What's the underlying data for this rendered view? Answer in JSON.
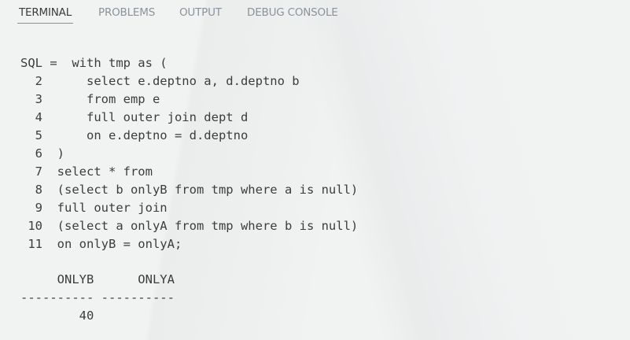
{
  "tabs": [
    {
      "label": "TERMINAL",
      "active": true
    },
    {
      "label": "PROBLEMS",
      "active": false
    },
    {
      "label": "OUTPUT",
      "active": false
    },
    {
      "label": "DEBUG CONSOLE",
      "active": false
    }
  ],
  "terminal": {
    "sql_lines": [
      "SQL =  with tmp as (",
      "  2      select e.deptno a, d.deptno b",
      "  3      from emp e",
      "  4      full outer join dept d",
      "  5      on e.deptno = d.deptno",
      "  6  )",
      "  7  select * from",
      "  8  (select b onlyB from tmp where a is null)",
      "  9  full outer join",
      " 10  (select a onlyA from tmp where b is null)",
      " 11  on onlyB = onlyA;"
    ],
    "result_header": "     ONLYB      ONLYA",
    "result_separator": "---------- ----------",
    "result_rows": [
      "        40"
    ]
  },
  "colors": {
    "background": "#f1f3f3",
    "active_tab_underline": "#5a9fb6",
    "text": "#3c3c3c",
    "inactive_tab": "#8a939b"
  }
}
